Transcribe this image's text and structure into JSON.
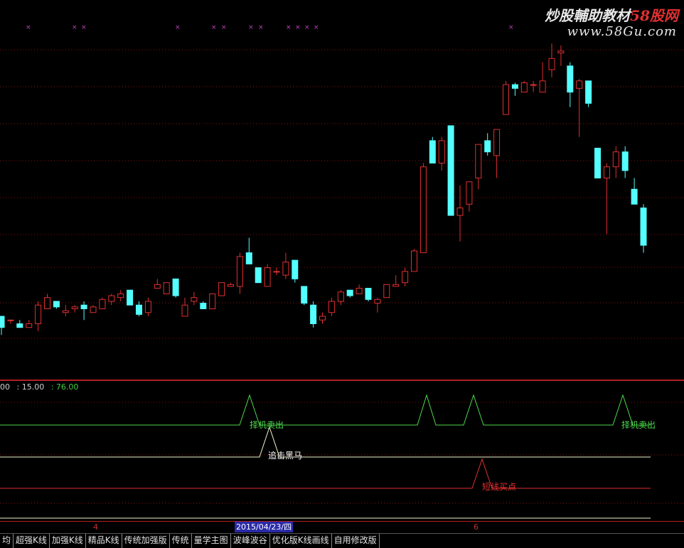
{
  "watermark": {
    "name_white": "炒股輔助教材",
    "name_red": "58股网",
    "url": "www.58Gu.com"
  },
  "indicator": {
    "values": [
      {
        "text": "00",
        "color": "#d0d0d0"
      },
      {
        "text": ": 15.00",
        "color": "#d0d0d0"
      },
      {
        "text": ": 76.00",
        "color": "#40d040"
      }
    ],
    "signals": [
      {
        "label": "择机卖出",
        "color": "#4cd84c"
      },
      {
        "label": "择机卖出",
        "color": "#4cd84c"
      },
      {
        "label": "追击黑马",
        "color": "#ffffff"
      },
      {
        "label": "短线买点",
        "color": "#e03030"
      }
    ]
  },
  "time_axis": {
    "labels": [
      "4",
      "6"
    ],
    "cursor_date": "2015/04/23/四"
  },
  "tabs": [
    "均",
    "超强K线",
    "加强K线",
    "精品K线",
    "传统加强版",
    "传统",
    "量学主图",
    "波峰波谷",
    "优化版K线画线",
    "自用修改版"
  ],
  "colors": {
    "up": "#e03030",
    "down": "#54ffff",
    "line_green": "#4cd84c",
    "line_white": "#f0f0c8",
    "line_red": "#e03030",
    "grid": "#8a1010"
  },
  "chart_data": {
    "type": "candlestick",
    "ohlc": [
      [
        13.2,
        13.2,
        12.7,
        12.9
      ],
      [
        13.1,
        13.1,
        13.0,
        13.1
      ],
      [
        13.0,
        13.1,
        12.9,
        12.9
      ],
      [
        12.9,
        13.1,
        12.9,
        13.0
      ],
      [
        13.0,
        13.6,
        12.8,
        13.5
      ],
      [
        13.4,
        13.8,
        13.4,
        13.7
      ],
      [
        13.6,
        13.6,
        13.4,
        13.45
      ],
      [
        13.3,
        13.5,
        13.2,
        13.35
      ],
      [
        13.4,
        13.5,
        13.3,
        13.45
      ],
      [
        13.5,
        13.6,
        13.1,
        13.4
      ],
      [
        13.3,
        13.5,
        13.3,
        13.45
      ],
      [
        13.4,
        13.7,
        13.4,
        13.65
      ],
      [
        13.6,
        13.8,
        13.5,
        13.75
      ],
      [
        13.7,
        13.9,
        13.6,
        13.8
      ],
      [
        13.9,
        13.9,
        13.5,
        13.5
      ],
      [
        13.5,
        13.6,
        13.2,
        13.25
      ],
      [
        13.3,
        13.7,
        13.2,
        13.6
      ],
      [
        13.95,
        14.2,
        13.95,
        14.05
      ],
      [
        13.8,
        14.1,
        13.8,
        14.1
      ],
      [
        14.2,
        14.2,
        13.7,
        13.75
      ],
      [
        13.2,
        13.7,
        13.2,
        13.5
      ],
      [
        13.6,
        13.85,
        13.5,
        13.7
      ],
      [
        13.55,
        13.6,
        13.4,
        13.4
      ],
      [
        13.4,
        13.8,
        13.4,
        13.8
      ],
      [
        13.75,
        14.1,
        13.75,
        14.1
      ],
      [
        14.0,
        14.1,
        14.0,
        14.05
      ],
      [
        14.0,
        14.9,
        13.8,
        14.8
      ],
      [
        14.9,
        15.3,
        14.6,
        14.6
      ],
      [
        14.5,
        14.5,
        14.1,
        14.1
      ],
      [
        14.0,
        14.6,
        14.0,
        14.5
      ],
      [
        14.4,
        14.5,
        14.3,
        14.4
      ],
      [
        14.3,
        14.9,
        14.2,
        14.65
      ],
      [
        14.7,
        14.7,
        14.1,
        14.2
      ],
      [
        14.0,
        14.0,
        13.5,
        13.55
      ],
      [
        13.5,
        13.6,
        12.9,
        13.0
      ],
      [
        13.1,
        13.3,
        13.0,
        13.2
      ],
      [
        13.3,
        13.7,
        13.2,
        13.6
      ],
      [
        13.6,
        13.9,
        13.5,
        13.85
      ],
      [
        13.9,
        13.9,
        13.7,
        13.75
      ],
      [
        13.8,
        14.05,
        13.8,
        13.95
      ],
      [
        13.95,
        13.95,
        13.6,
        13.65
      ],
      [
        13.55,
        13.7,
        13.3,
        13.65
      ],
      [
        13.7,
        14.05,
        13.7,
        14.05
      ],
      [
        14.0,
        14.3,
        14.0,
        14.05
      ],
      [
        14.1,
        14.5,
        14.0,
        14.4
      ],
      [
        14.4,
        15.0,
        14.4,
        14.95
      ],
      [
        14.9,
        17.3,
        14.9,
        17.2
      ],
      [
        17.9,
        18.0,
        17.3,
        17.3
      ],
      [
        17.3,
        18.0,
        17.1,
        17.9
      ],
      [
        18.3,
        18.3,
        15.9,
        15.9
      ],
      [
        15.9,
        16.7,
        15.2,
        16.1
      ],
      [
        16.2,
        16.8,
        16.0,
        16.8
      ],
      [
        16.9,
        17.7,
        16.6,
        17.8
      ],
      [
        17.9,
        18.1,
        17.5,
        17.6
      ],
      [
        17.5,
        18.2,
        16.9,
        18.2
      ],
      [
        18.6,
        19.5,
        18.6,
        19.4
      ],
      [
        19.4,
        19.45,
        19.1,
        19.3
      ],
      [
        19.2,
        19.5,
        19.2,
        19.45
      ],
      [
        19.4,
        19.5,
        19.2,
        19.4
      ],
      [
        19.2,
        20.0,
        19.2,
        19.5
      ],
      [
        19.8,
        20.5,
        19.6,
        20.1
      ],
      [
        20.25,
        20.45,
        19.9,
        20.3
      ],
      [
        19.9,
        20.0,
        18.8,
        19.2
      ],
      [
        19.3,
        19.55,
        18.0,
        19.5
      ],
      [
        19.5,
        19.5,
        18.8,
        18.9
      ],
      [
        17.7,
        17.7,
        16.9,
        16.9
      ],
      [
        16.9,
        17.3,
        15.4,
        17.2
      ],
      [
        17.2,
        17.75,
        16.9,
        17.6
      ],
      [
        17.6,
        17.75,
        16.9,
        17.1
      ],
      [
        16.6,
        16.9,
        16.2,
        16.2
      ],
      [
        16.1,
        16.2,
        14.9,
        15.1
      ]
    ]
  }
}
